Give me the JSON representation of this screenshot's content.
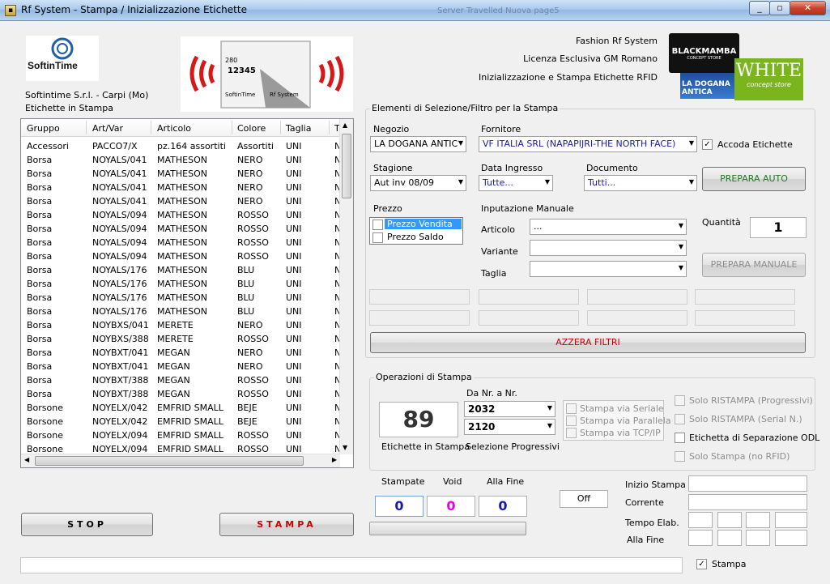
{
  "window": {
    "title": "Rf System - Stampa / Inizializzazione Etichette",
    "icon": "tag-icon"
  },
  "taskbar_hint": "Server Travelled Nuova page5",
  "logo": {
    "brand": "SoftinTime",
    "company": "Softintime S.r.l. - Carpi (Mo)",
    "section": "Etichette in Stampa"
  },
  "header": {
    "line1": "Fashion Rf System",
    "line2": "Licenza Esclusiva GM Romano",
    "line3": "Inizializzazione e Stampa Etichette RFID"
  },
  "brand_logos": {
    "blackmamba": "BLACKMAMBA",
    "blackmamba_sub": "CONCEPT STORE",
    "ladogana": "LA DOGANA ANTICA",
    "white": "WHITE",
    "white_sub": "concept store"
  },
  "rfid_tag": {
    "brand": "SoftinTime",
    "product": "Rf System",
    "num": "280",
    "code": "12345"
  },
  "grid": {
    "columns": [
      "Gruppo",
      "Art/Var",
      "Articolo",
      "Colore",
      "Taglia",
      "T"
    ],
    "rows": [
      [
        "Accessori",
        "PACCO7/X",
        "pz.164 assortiti",
        "Assortiti",
        "UNI",
        "N"
      ],
      [
        "Borsa",
        "NOYALS/041",
        "MATHESON",
        "NERO",
        "UNI",
        "N"
      ],
      [
        "Borsa",
        "NOYALS/041",
        "MATHESON",
        "NERO",
        "UNI",
        "N"
      ],
      [
        "Borsa",
        "NOYALS/041",
        "MATHESON",
        "NERO",
        "UNI",
        "N"
      ],
      [
        "Borsa",
        "NOYALS/041",
        "MATHESON",
        "NERO",
        "UNI",
        "N"
      ],
      [
        "Borsa",
        "NOYALS/094",
        "MATHESON",
        "ROSSO",
        "UNI",
        "N"
      ],
      [
        "Borsa",
        "NOYALS/094",
        "MATHESON",
        "ROSSO",
        "UNI",
        "N"
      ],
      [
        "Borsa",
        "NOYALS/094",
        "MATHESON",
        "ROSSO",
        "UNI",
        "N"
      ],
      [
        "Borsa",
        "NOYALS/094",
        "MATHESON",
        "ROSSO",
        "UNI",
        "N"
      ],
      [
        "Borsa",
        "NOYALS/176",
        "MATHESON",
        "BLU",
        "UNI",
        "N"
      ],
      [
        "Borsa",
        "NOYALS/176",
        "MATHESON",
        "BLU",
        "UNI",
        "N"
      ],
      [
        "Borsa",
        "NOYALS/176",
        "MATHESON",
        "BLU",
        "UNI",
        "N"
      ],
      [
        "Borsa",
        "NOYALS/176",
        "MATHESON",
        "BLU",
        "UNI",
        "N"
      ],
      [
        "Borsa",
        "NOYBXS/041",
        "MERETE",
        "NERO",
        "UNI",
        "N"
      ],
      [
        "Borsa",
        "NOYBXS/388",
        "MERETE",
        "ROSSO",
        "UNI",
        "N"
      ],
      [
        "Borsa",
        "NOYBXT/041",
        "MEGAN",
        "NERO",
        "UNI",
        "N"
      ],
      [
        "Borsa",
        "NOYBXT/041",
        "MEGAN",
        "NERO",
        "UNI",
        "N"
      ],
      [
        "Borsa",
        "NOYBXT/388",
        "MEGAN",
        "ROSSO",
        "UNI",
        "N"
      ],
      [
        "Borsa",
        "NOYBXT/388",
        "MEGAN",
        "ROSSO",
        "UNI",
        "N"
      ],
      [
        "Borsone",
        "NOYELX/042",
        "EMFRID SMALL",
        "BEJE",
        "UNI",
        "N"
      ],
      [
        "Borsone",
        "NOYELX/042",
        "EMFRID SMALL",
        "BEJE",
        "UNI",
        "N"
      ],
      [
        "Borsone",
        "NOYELX/094",
        "EMFRID SMALL",
        "ROSSO",
        "UNI",
        "N"
      ],
      [
        "Borsone",
        "NOYELX/094",
        "EMFRID SMALL",
        "ROSSO",
        "UNI",
        "N"
      ]
    ]
  },
  "filters": {
    "group_label": "Elementi di Selezione/Filtro per la Stampa",
    "negozio_label": "Negozio",
    "negozio_value": "LA DOGANA ANTIC",
    "fornitore_label": "Fornitore",
    "fornitore_value": "VF ITALIA SRL (NAPAPIJRI-THE NORTH FACE)",
    "accoda_label": "Accoda Etichette",
    "accoda_check": "✓",
    "stagione_label": "Stagione",
    "stagione_value": "Aut inv 08/09",
    "data_label": "Data Ingresso",
    "data_value": "Tutte...",
    "documento_label": "Documento",
    "documento_value": "Tutti...",
    "prepara_auto": "PREPARA AUTO",
    "prezzo_label": "Prezzo",
    "prezzo_options": [
      "Prezzo Vendita",
      "Prezzo Saldo"
    ],
    "inputazione_label": "Inputazione Manuale",
    "articolo_label": "Articolo",
    "articolo_value": "...",
    "variante_label": "Variante",
    "taglia_label": "Taglia",
    "quantita_label": "Quantità",
    "quantita_value": "1",
    "prepara_manuale": "PREPARA MANUALE",
    "azzera": "AZZERA FILTRI"
  },
  "ops": {
    "group_label": "Operazioni di Stampa",
    "count": "89",
    "count_label": "Etichette in Stampa",
    "range_label": "Da Nr. a Nr.",
    "from": "2032",
    "to": "2120",
    "progressivi_label": "Selezione Progressivi",
    "modes": [
      "Stampa via Seriale",
      "Stampa via Parallela",
      "Stampa via TCP/IP"
    ],
    "options": [
      "Solo RISTAMPA (Progressivi)",
      "Solo RISTAMPA (Serial N.)",
      "Etichetta di Separazione ODL",
      "Solo Stampa (no RFID)"
    ]
  },
  "counters": {
    "stampate_label": "Stampate",
    "stampate": "0",
    "void_label": "Void",
    "void": "0",
    "fine_label": "Alla Fine",
    "fine": "0",
    "off": "Off"
  },
  "timing": {
    "inizio": "Inizio Stampa",
    "corrente": "Corrente",
    "tempo": "Tempo Elab.",
    "fine": "Alla Fine"
  },
  "buttons": {
    "stop": "STOP",
    "stampa": "STAMPA"
  },
  "footer": {
    "stampa_check_label": "Stampa",
    "stampa_check": "✓"
  },
  "colors": {
    "accent_red": "#cc0000",
    "green_text": "#1e7a1e",
    "blue_text": "#1a1aa6",
    "magenta": "#e600e6"
  }
}
